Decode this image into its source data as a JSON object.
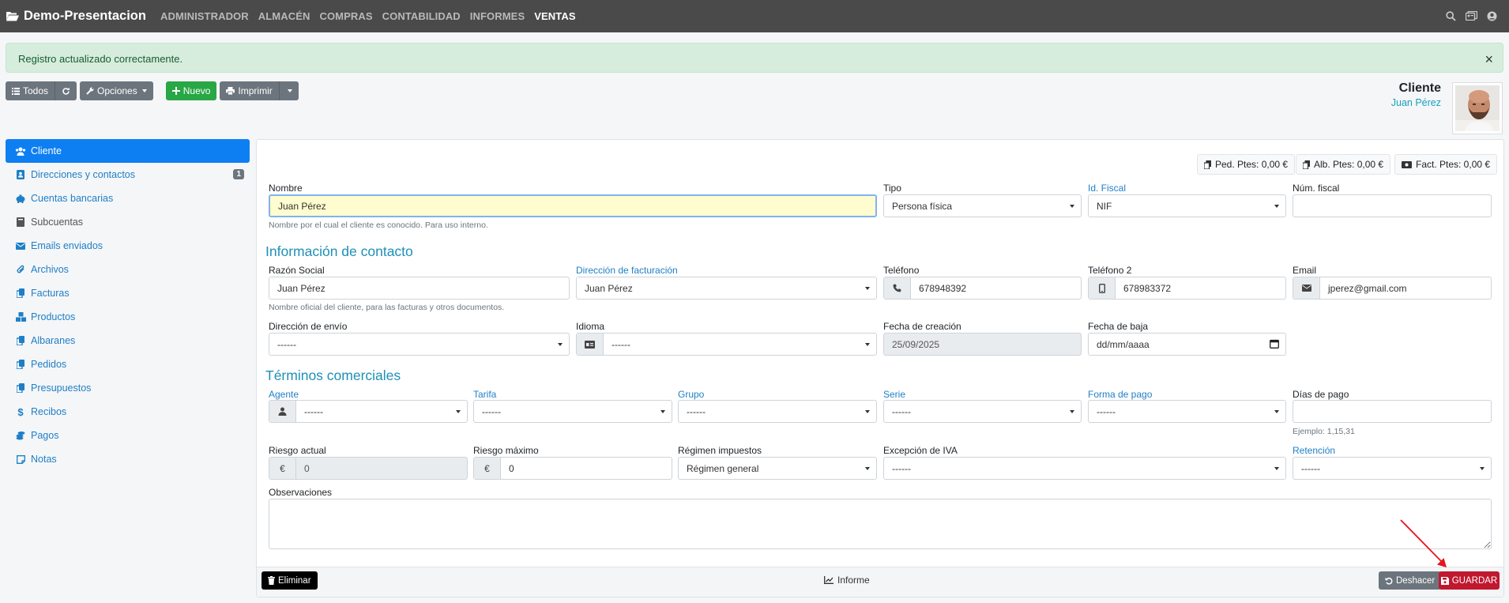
{
  "navbar": {
    "brand": "Demo-Presentacion",
    "menu": [
      "ADMINISTRADOR",
      "ALMACÉN",
      "COMPRAS",
      "CONTABILIDAD",
      "INFORMES",
      "VENTAS"
    ],
    "active_menu": "VENTAS",
    "icons": [
      "search-icon",
      "id-card-icon",
      "user-circle-icon"
    ]
  },
  "alert": {
    "message": "Registro actualizado correctamente.",
    "close": "×"
  },
  "toolbar": {
    "all_label": "Todos",
    "options_label": "Opciones",
    "new_label": "Nuevo",
    "print_label": "Imprimir"
  },
  "header": {
    "title": "Cliente",
    "subtitle": "Juan Pérez"
  },
  "sidebar": {
    "items": [
      {
        "label": "Cliente",
        "icon": "users-icon"
      },
      {
        "label": "Direcciones y contactos",
        "icon": "address-book-icon",
        "badge": "1"
      },
      {
        "label": "Cuentas bancarias",
        "icon": "piggy-bank-icon"
      },
      {
        "label": "Subcuentas",
        "icon": "book-icon"
      },
      {
        "label": "Emails enviados",
        "icon": "envelope-icon"
      },
      {
        "label": "Archivos",
        "icon": "paperclip-icon"
      },
      {
        "label": "Facturas",
        "icon": "copy-icon"
      },
      {
        "label": "Productos",
        "icon": "cubes-icon"
      },
      {
        "label": "Albaranes",
        "icon": "copy-icon"
      },
      {
        "label": "Pedidos",
        "icon": "copy-icon"
      },
      {
        "label": "Presupuestos",
        "icon": "copy-icon"
      },
      {
        "label": "Recibos",
        "icon": "dollar-icon"
      },
      {
        "label": "Pagos",
        "icon": "coins-icon"
      },
      {
        "label": "Notas",
        "icon": "sticky-note-icon"
      }
    ]
  },
  "pending": {
    "orders": "Ped. Ptes: 0,00 €",
    "delivery": "Alb. Ptes: 0,00 €",
    "invoices": "Fact. Ptes: 0,00 €"
  },
  "form": {
    "nombre": {
      "label": "Nombre",
      "value": "Juan Pérez",
      "help": "Nombre por el cual el cliente es conocido. Para uso interno."
    },
    "tipo": {
      "label": "Tipo",
      "value": "Persona física"
    },
    "id_fiscal": {
      "label": "Id. Fiscal",
      "value": "NIF"
    },
    "num_fiscal": {
      "label": "Núm. fiscal",
      "value": ""
    },
    "contact_section": "Información de contacto",
    "razon_social": {
      "label": "Razón Social",
      "value": "Juan Pérez",
      "help": "Nombre oficial del cliente, para las facturas y otros documentos."
    },
    "dir_facturacion": {
      "label": "Dirección de facturación",
      "value": "Juan Pérez"
    },
    "telefono": {
      "label": "Teléfono",
      "value": "678948392"
    },
    "telefono2": {
      "label": "Teléfono 2",
      "value": "678983372"
    },
    "email": {
      "label": "Email",
      "value": "jperez@gmail.com"
    },
    "dir_envio": {
      "label": "Dirección de envío",
      "value": "------"
    },
    "idioma": {
      "label": "Idioma",
      "value": "------"
    },
    "fecha_creacion": {
      "label": "Fecha de creación",
      "value": "25/09/2025"
    },
    "fecha_baja": {
      "label": "Fecha de baja",
      "value": "dd/mm/aaaa"
    },
    "terms_section": "Términos comerciales",
    "agente": {
      "label": "Agente",
      "value": "------"
    },
    "tarifa": {
      "label": "Tarifa",
      "value": "------"
    },
    "grupo": {
      "label": "Grupo",
      "value": "------"
    },
    "serie": {
      "label": "Serie",
      "value": "------"
    },
    "forma_pago": {
      "label": "Forma de pago",
      "value": "------"
    },
    "dias_pago": {
      "label": "Días de pago",
      "value": "",
      "help": "Ejemplo: 1,15,31"
    },
    "riesgo_actual": {
      "label": "Riesgo actual",
      "value": "0",
      "addon": "€"
    },
    "riesgo_maximo": {
      "label": "Riesgo máximo",
      "value": "0",
      "addon": "€"
    },
    "regimen": {
      "label": "Régimen impuestos",
      "value": "Régimen general"
    },
    "excepcion_iva": {
      "label": "Excepción de IVA",
      "value": "------"
    },
    "retencion": {
      "label": "Retención",
      "value": "------"
    },
    "observaciones": {
      "label": "Observaciones",
      "value": ""
    }
  },
  "footer": {
    "delete_label": "Eliminar",
    "report_label": "Informe",
    "undo_label": "Deshacer",
    "save_label": "GUARDAR"
  },
  "colors": {
    "primary": "#0d7ff2",
    "success": "#28a745",
    "danger": "#c0182f",
    "link": "#1e7fc7",
    "section": "#1e90b7"
  }
}
